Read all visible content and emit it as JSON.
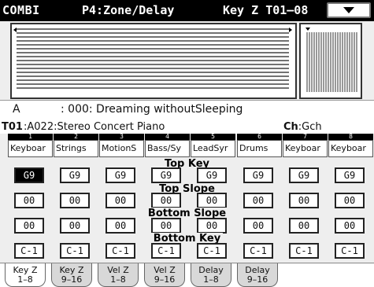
{
  "title": {
    "mode": "COMBI",
    "page": "P4:Zone/Delay",
    "tab_prefix": "Key Z",
    "timbre_range": "T01–08"
  },
  "icons": {
    "menu": "chevron-down-icon"
  },
  "combi": {
    "bank": "A",
    "name": ": 000: Dreaming withoutSleeping"
  },
  "timbre": {
    "id": "T01",
    "program": ":A022:Stereo Concert Piano",
    "ch_label": "Ch",
    "ch_value": ":Gch"
  },
  "timbres": [
    {
      "num": "1",
      "program": "Keyboar",
      "top_key": "G9",
      "top_slope": "00",
      "bottom_slope": "00",
      "bottom_key": "C-1"
    },
    {
      "num": "2",
      "program": "Strings",
      "top_key": "G9",
      "top_slope": "00",
      "bottom_slope": "00",
      "bottom_key": "C-1"
    },
    {
      "num": "3",
      "program": "MotionS",
      "top_key": "G9",
      "top_slope": "00",
      "bottom_slope": "00",
      "bottom_key": "C-1"
    },
    {
      "num": "4",
      "program": "Bass/Sy",
      "top_key": "G9",
      "top_slope": "00",
      "bottom_slope": "00",
      "bottom_key": "C-1"
    },
    {
      "num": "5",
      "program": "LeadSyr",
      "top_key": "G9",
      "top_slope": "00",
      "bottom_slope": "00",
      "bottom_key": "C-1"
    },
    {
      "num": "6",
      "program": "Drums",
      "top_key": "G9",
      "top_slope": "00",
      "bottom_slope": "00",
      "bottom_key": "C-1"
    },
    {
      "num": "7",
      "program": "Keyboar",
      "top_key": "G9",
      "top_slope": "00",
      "bottom_slope": "00",
      "bottom_key": "C-1"
    },
    {
      "num": "8",
      "program": "Keyboar",
      "top_key": "G9",
      "top_slope": "00",
      "bottom_slope": "00",
      "bottom_key": "C-1"
    }
  ],
  "labels": {
    "top_key": "Top Key",
    "top_slope": "Top Slope",
    "bottom_slope": "Bottom Slope",
    "bottom_key": "Bottom Key"
  },
  "tabs": [
    {
      "line1": "Key Z",
      "line2": "1–8",
      "active": true
    },
    {
      "line1": "Key Z",
      "line2": "9–16",
      "active": false
    },
    {
      "line1": "Vel Z",
      "line2": "1–8",
      "active": false
    },
    {
      "line1": "Vel Z",
      "line2": "9–16",
      "active": false
    },
    {
      "line1": "Delay",
      "line2": "1–8",
      "active": false
    },
    {
      "line1": "Delay",
      "line2": "9–16",
      "active": false
    }
  ]
}
